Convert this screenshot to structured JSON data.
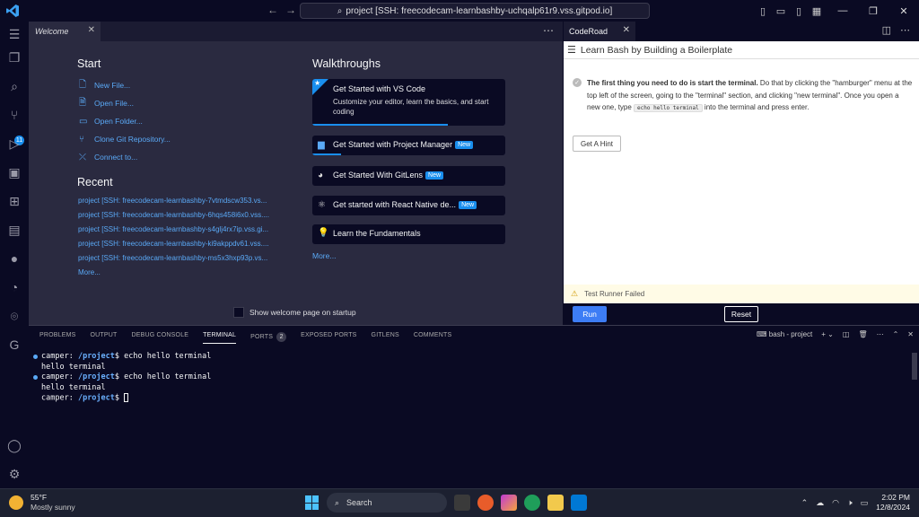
{
  "titlebar": {
    "search_text": "project [SSH: freecodecam-learnbashby-uchqalp61r9.vss.gitpod.io]"
  },
  "activity_bar": {
    "scm_badge": "11"
  },
  "welcome": {
    "tab_label": "Welcome",
    "start": {
      "title": "Start",
      "items": [
        {
          "label": "New File...",
          "icon": "new-file-icon"
        },
        {
          "label": "Open File...",
          "icon": "open-file-icon"
        },
        {
          "label": "Open Folder...",
          "icon": "open-folder-icon"
        },
        {
          "label": "Clone Git Repository...",
          "icon": "clone-repo-icon"
        },
        {
          "label": "Connect to...",
          "icon": "remote-connect-icon"
        }
      ]
    },
    "recent": {
      "title": "Recent",
      "items": [
        "project [SSH: freecodecam-learnbashby-7vtmdscw353.vs...",
        "project [SSH: freecodecam-learnbashby-6hqs458i6x0.vss....",
        "project [SSH: freecodecam-learnbashby-s4glj4rx7ip.vss.gi...",
        "project [SSH: freecodecam-learnbashby-ki9akppdv61.vss....",
        "project [SSH: freecodecam-learnbashby-ms5x3hxp93p.vs..."
      ],
      "more": "More..."
    },
    "walkthroughs": {
      "title": "Walkthroughs",
      "featured": {
        "label": "Get Started with VS Code",
        "description": "Customize your editor, learn the basics, and start coding",
        "progress": 0.7
      },
      "items": [
        {
          "label": "Get Started with Project Manager",
          "badge": "New",
          "icon": "folder-icon",
          "progress": 0.15
        },
        {
          "label": "Get Started With GitLens",
          "badge": "New",
          "icon": "gitlens-icon"
        },
        {
          "label": "Get started with React Native de...",
          "badge": "New",
          "icon": "react-icon"
        },
        {
          "label": "Learn the Fundamentals",
          "badge": "",
          "icon": "lightbulb-icon"
        }
      ],
      "more": "More..."
    },
    "show_on_startup": "Show welcome page on startup"
  },
  "coderoad": {
    "tab_label": "CodeRoad",
    "title": "Learn Bash by Building a Boilerplate",
    "step_bold": "The first thing you need to do is start the terminal.",
    "step_text_1": " Do that by clicking the \"hamburger\" menu at the top left of the screen, going to the \"terminal\" section, and clicking \"new terminal\". Once you open a new one, type ",
    "step_code": "echo hello terminal",
    "step_text_2": " into the terminal and press enter.",
    "hint_button": "Get A Hint",
    "status": "Test Runner Failed",
    "run_button": "Run",
    "reset_button": "Reset"
  },
  "panel": {
    "tabs": [
      "PROBLEMS",
      "OUTPUT",
      "DEBUG CONSOLE",
      "TERMINAL",
      "PORTS",
      "EXPOSED PORTS",
      "GITLENS",
      "COMMENTS"
    ],
    "active_tab": "TERMINAL",
    "ports_count": "2",
    "terminal_name": "bash - project",
    "terminal": {
      "prompt_user": "camper: ",
      "prompt_path": "/project",
      "prompt_sign": "$",
      "command": " echo hello terminal",
      "output": "hello terminal"
    }
  },
  "taskbar": {
    "temperature": "55°F",
    "weather": "Mostly sunny",
    "search_placeholder": "Search",
    "time": "2:02 PM",
    "date": "12/8/2024"
  },
  "colors": {
    "accent": "#198eee",
    "run_button": "#3d7df5",
    "link": "#5aa9f6"
  }
}
